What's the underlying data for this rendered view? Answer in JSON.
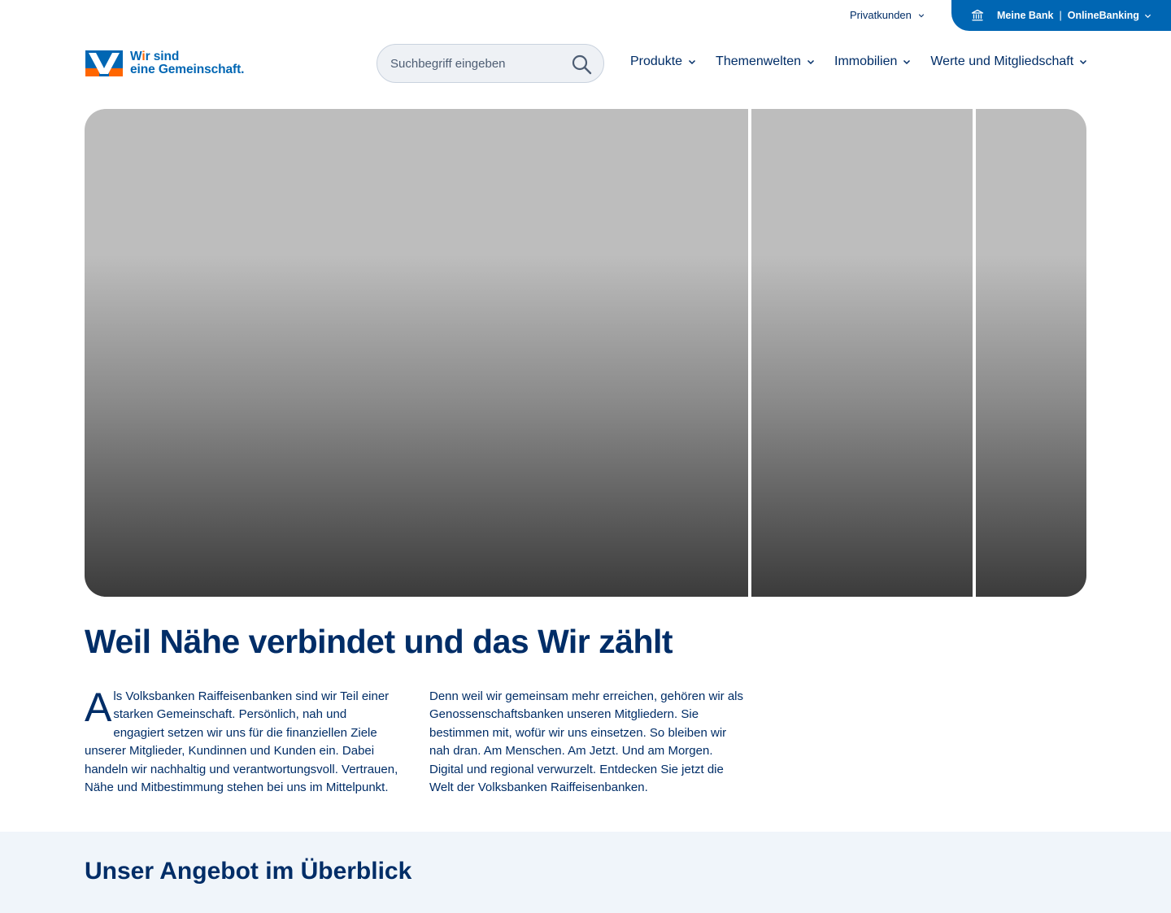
{
  "topbar": {
    "segment_label": "Privatkunden",
    "bank_label": "Meine Bank",
    "separator": "|",
    "banking_label": "OnlineBanking"
  },
  "logo": {
    "line1_a": "W",
    "line1_dot": "i",
    "line1_b": "r sind",
    "line2": "eine Gemeinschaft."
  },
  "search": {
    "placeholder": "Suchbegriff eingeben"
  },
  "nav": {
    "items": [
      {
        "label": "Produkte"
      },
      {
        "label": "Themenwelten"
      },
      {
        "label": "Immobilien"
      },
      {
        "label": "Werte und Mitgliedschaft"
      }
    ]
  },
  "intro": {
    "title": "Weil Nähe verbindet und das Wir zählt",
    "dropcap": "A",
    "body": "ls Volksbanken Raiffeisenbanken sind wir Teil einer starken Gemeinschaft. Persönlich, nah und engagiert setzen wir uns für die finanziellen Ziele unserer Mitglieder, Kundinnen und Kunden ein. Dabei handeln wir nachhaltig und verantwortungsvoll. Vertrauen, Nähe und Mitbestimmung stehen bei uns im Mittelpunkt. Denn weil wir gemeinsam mehr erreichen, gehören wir als Genossenschaftsbanken unseren Mitgliedern. Sie bestimmen mit, wofür wir uns einsetzen. So bleiben wir nah dran. Am Menschen. Am Jetzt. Und am Morgen. Digital und regional verwurzelt. Entdecken Sie jetzt die Welt der Volksbanken Raiffeisenbanken."
  },
  "offer": {
    "title": "Unser Angebot im Überblick"
  },
  "colors": {
    "primary_blue": "#0066b3",
    "navy": "#002d67",
    "orange": "#ff6600",
    "section_bg": "#f0f5fa"
  }
}
